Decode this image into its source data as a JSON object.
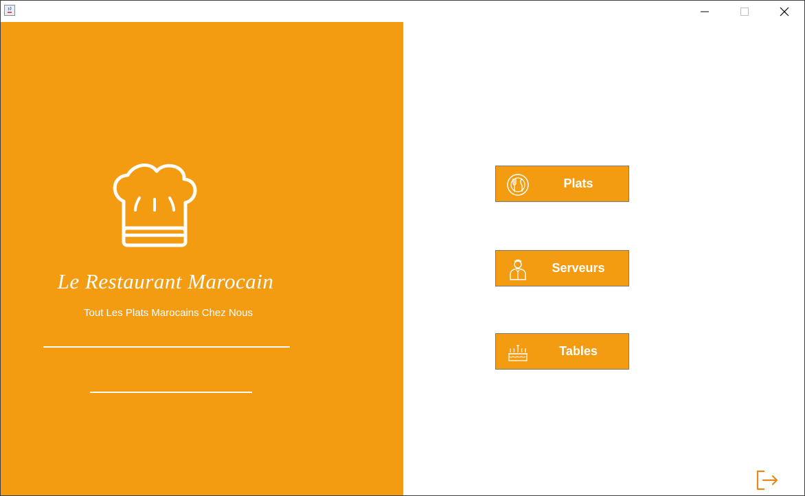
{
  "window": {
    "controls": {
      "minimize_icon": "minimize-icon",
      "maximize_icon": "maximize-icon",
      "close_icon": "close-icon"
    }
  },
  "brand": {
    "title": "Le Restaurant Marocain",
    "subtitle": "Tout Les Plats Marocains Chez Nous",
    "logo_icon": "chef-hat-icon"
  },
  "menu": {
    "plats": {
      "label": "Plats",
      "icon": "plate-cutlery-icon"
    },
    "serveurs": {
      "label": "Serveurs",
      "icon": "waiter-icon"
    },
    "tables": {
      "label": "Tables",
      "icon": "dining-table-icon"
    }
  },
  "footer": {
    "logout_icon": "logout-icon"
  },
  "colors": {
    "accent": "#f39c12",
    "text_on_accent": "#ffffff",
    "logout_icon": "#e08a1e"
  }
}
